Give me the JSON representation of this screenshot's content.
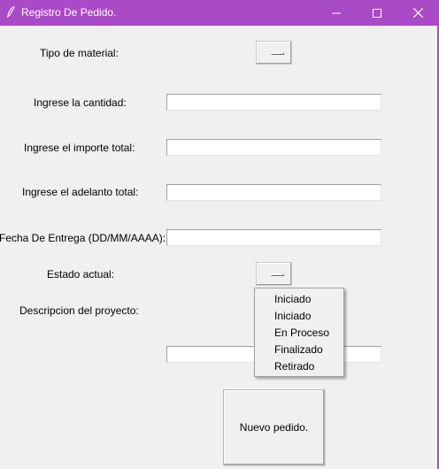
{
  "window": {
    "title": "Registro De Pedido."
  },
  "form": {
    "tipo_material_label": "Tipo de material:",
    "cantidad_label": "Ingrese la cantidad:",
    "importe_label": "Ingrese el importe total:",
    "adelanto_label": "Ingrese el adelanto total:",
    "fecha_label": "Fecha De Entrega (DD/MM/AAAA):",
    "estado_label": "Estado actual:",
    "descripcion_label": "Descripcion del proyecto:",
    "cantidad_value": "",
    "importe_value": "",
    "adelanto_value": "",
    "fecha_value": "",
    "descripcion_value": "",
    "submit_label": "Nuevo pedido."
  },
  "estado_menu": {
    "items": [
      "Iniciado",
      "Iniciado",
      "En Proceso",
      "Finalizado",
      "Retirado"
    ]
  },
  "colors": {
    "titlebar": "#a94ac7",
    "background": "#f0f0f0"
  }
}
